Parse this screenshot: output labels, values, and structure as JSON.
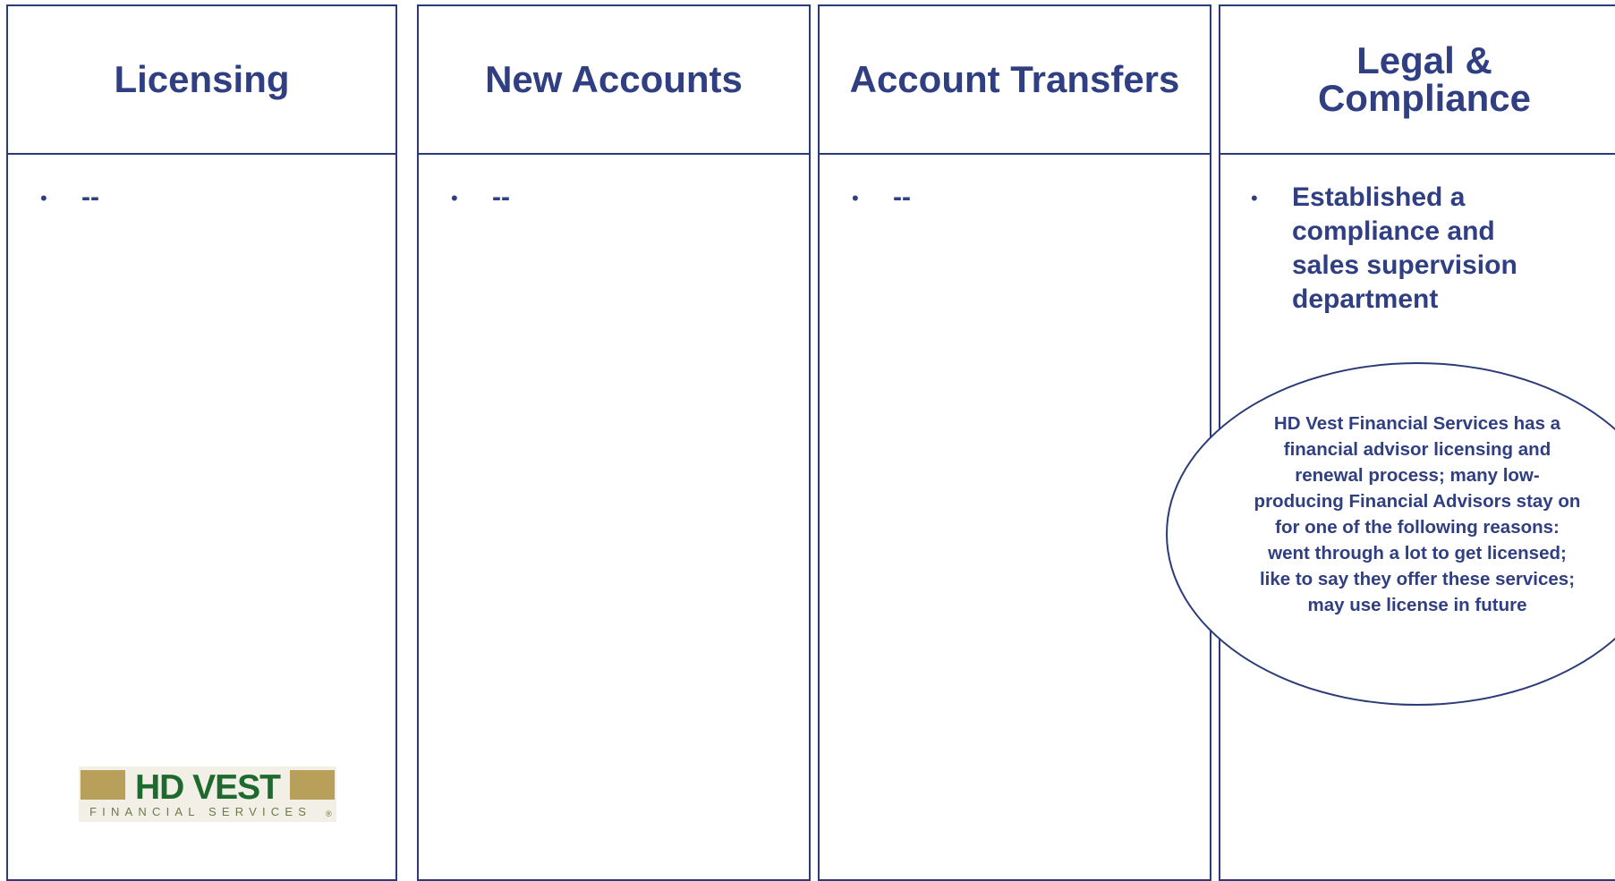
{
  "columns": [
    {
      "title": "Licensing",
      "bullet": "--"
    },
    {
      "title": "New Accounts",
      "bullet": "--"
    },
    {
      "title": "Account Transfers",
      "bullet": "--"
    },
    {
      "title": "Legal & Compliance",
      "bullet": "Established a compliance and sales supervision department"
    }
  ],
  "bullet_symbol": "•",
  "callout": {
    "text": "HD Vest Financial Services has a financial advisor licensing and renewal process; many low-producing Financial Advisors stay on for one of the following reasons: went through a lot to get licensed; like to say they offer these services; may use license in future"
  },
  "logo": {
    "main": "HD VEST",
    "sub": "FINANCIAL SERVICES",
    "mark": "®"
  },
  "colors": {
    "border": "#2a3b78",
    "text": "#2f3f82",
    "logo_green": "#1e6a2e",
    "logo_gold": "#b8a05a"
  }
}
